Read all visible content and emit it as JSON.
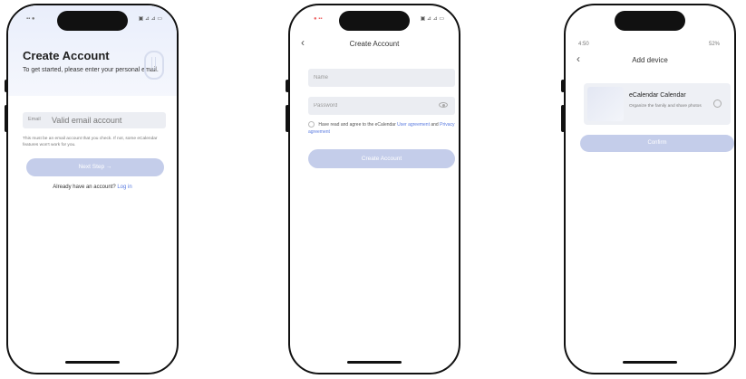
{
  "screen1": {
    "status_time": "",
    "title": "Create Account",
    "subtitle": "To get started, please enter your personal email.",
    "email_label": "Email",
    "email_placeholder": "Valid email account",
    "note": "This must be an email account that you check. If not, some eCalendar features won't work for you.",
    "next_button": "Next Step →",
    "login_prompt": "Already have an account?",
    "login_link": "Log in"
  },
  "screen2": {
    "title": "Create Account",
    "name_placeholder": "Name",
    "password_placeholder": "Password",
    "agree_text": "Have read and agree to the eCalendar",
    "user_agreement": "User agreement",
    "and_text": "and",
    "privacy_agreement": "Privacy agreement",
    "create_button": "Create Account"
  },
  "screen3": {
    "status_left": "4:50",
    "status_right": "52%",
    "title": "Add device",
    "device_name": "eCalendar Calendar",
    "device_desc": "Organize the family and share photos",
    "confirm_button": "Confirm"
  }
}
